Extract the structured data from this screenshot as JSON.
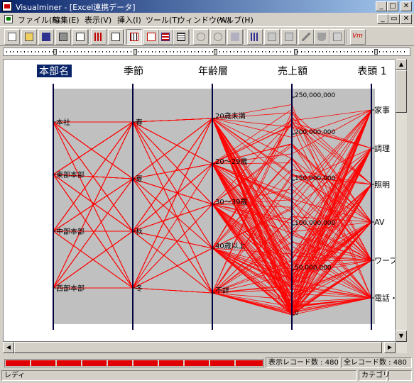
{
  "window": {
    "title": "Visualminer - [Excel連携データ]"
  },
  "menu": [
    "ファイル(F)",
    "編集(E)",
    "表示(V)",
    "挿入(I)",
    "ツール(T)",
    "ウィンドウ(W)",
    "ヘルプ(H)"
  ],
  "axes": [
    {
      "name": "本部名",
      "selected": true,
      "labels": [
        "本社",
        "東部本部",
        "中部本部",
        "西部本部"
      ]
    },
    {
      "name": "季節",
      "selected": false,
      "labels": [
        "春",
        "夏",
        "秋",
        "冬"
      ]
    },
    {
      "name": "年齢層",
      "selected": false,
      "labels": [
        "20歳未満",
        "20～29歳",
        "30～39歳",
        "40歳以上",
        "不詳"
      ]
    },
    {
      "name": "売上額",
      "selected": false,
      "labels": [
        "250,000,000",
        "200,000,000",
        "150,000,000",
        "100,000,000",
        "50,000,000",
        "0"
      ]
    },
    {
      "name": "表頭 1",
      "selected": false,
      "labels": [
        "家事",
        "調理",
        "照明",
        "AV",
        "ワープロ",
        "電話・ファ"
      ]
    }
  ],
  "status": {
    "displayed": "表示レコード数 : 480",
    "total": "全レコード数 : 480",
    "ready": "レディ",
    "category": "カテゴリ"
  },
  "colors": {
    "lines": "#ff0000",
    "axis": "#000040",
    "plot_bg": "#c0c0c0"
  }
}
